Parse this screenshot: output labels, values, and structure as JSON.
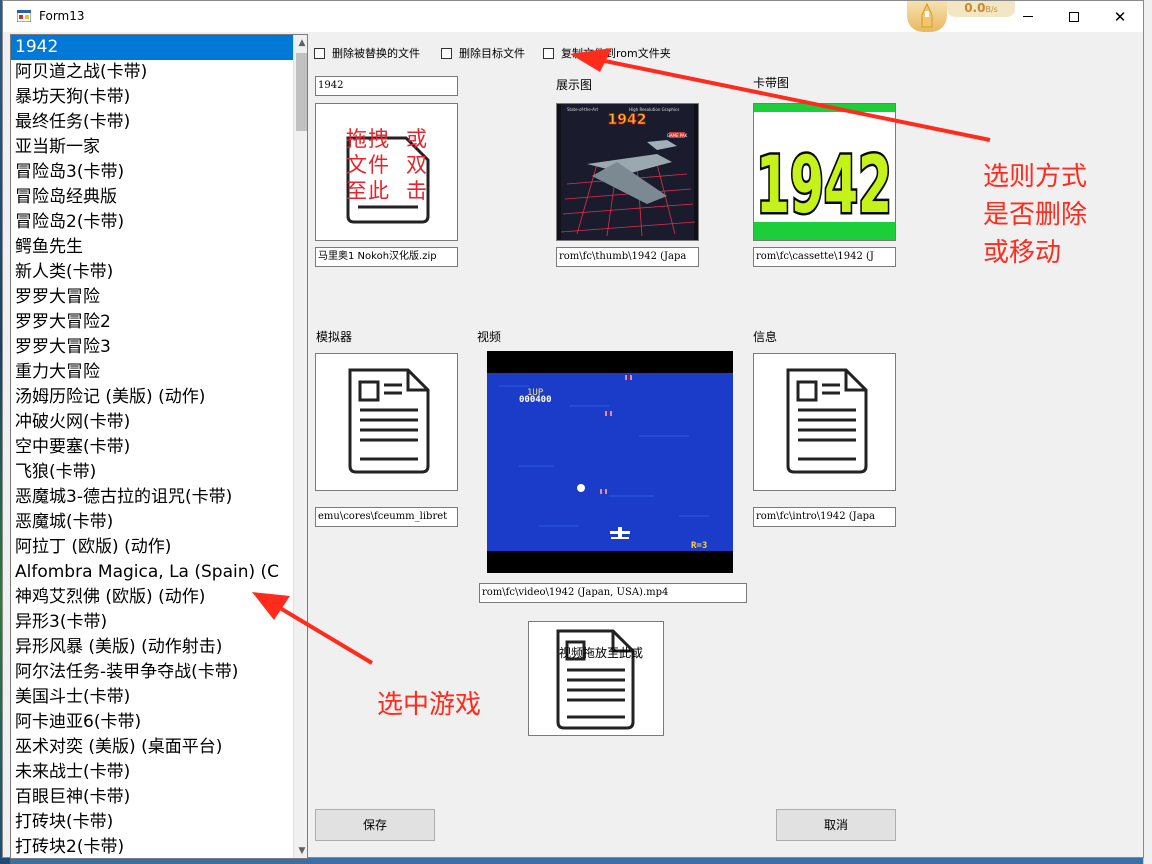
{
  "window": {
    "title": "Form13",
    "speed_text": "0.0",
    "speed_unit": "B/s"
  },
  "game_list": {
    "selected_index": 0,
    "items": [
      "1942",
      "阿贝道之战(卡带)",
      "暴坊天狗(卡带)",
      "最终任务(卡带)",
      "亚当斯一家",
      "冒险岛3(卡带)",
      "冒险岛经典版",
      "冒险岛2(卡带)",
      "鳄鱼先生",
      "新人类(卡带)",
      "罗罗大冒险",
      "罗罗大冒险2",
      "罗罗大冒险3",
      "重力大冒险",
      "汤姆历险记 (美版) (动作)",
      "冲破火网(卡带)",
      "空中要塞(卡带)",
      "飞狼(卡带)",
      "恶魔城3-德古拉的诅咒(卡带)",
      "恶魔城(卡带)",
      "阿拉丁 (欧版) (动作)",
      "Alfombra Magica, La (Spain) (C",
      "神鸡艾烈佛 (欧版) (动作)",
      "异形3(卡带)",
      "异形风暴 (美版) (动作射击)",
      "阿尔法任务-装甲争夺战(卡带)",
      "美国斗士(卡带)",
      "阿卡迪亚6(卡带)",
      "巫术对奕 (美版) (桌面平台)",
      "未来战士(卡带)",
      "百眼巨神(卡带)",
      "打砖块(卡带)",
      "打砖块2(卡带)"
    ]
  },
  "options": {
    "delete_replaced": "删除被替换的文件",
    "delete_target": "删除目标文件",
    "copy_to_rom": "复制文件到rom文件夹"
  },
  "rom": {
    "name_value": "1942",
    "drop_text": [
      "拖拽",
      "文件",
      "至此"
    ],
    "drop_text2": [
      "或",
      "双",
      "击"
    ],
    "path": "马里奥1 Nokoh汉化版.zip"
  },
  "display": {
    "label": "展示图",
    "path": "rom\\fc\\thumb\\1942 (Japa",
    "cover_title": "1942",
    "cover_top_left": "State-of-the-Art",
    "cover_top_right": "High Resolution Graphics",
    "cover_badge": "GAME PAK"
  },
  "cassette": {
    "label": "卡带图",
    "path": "rom\\fc\\cassette\\1942 (J",
    "logo_text": "1942"
  },
  "emulator": {
    "label": "模拟器",
    "path": "emu\\cores\\fceumm_libret"
  },
  "video": {
    "label": "视频",
    "path": "rom\\fc\\video\\1942 (Japan, USA).mp4",
    "hud_1up": "1UP",
    "hud_score": "000400",
    "hud_lives": "R=3"
  },
  "info": {
    "label": "信息",
    "path": "rom\\fc\\intro\\1942 (Japa"
  },
  "video_drop": {
    "text": "视频拖放至此或"
  },
  "buttons": {
    "save": "保存",
    "cancel": "取消"
  },
  "annotations": {
    "choose_mode": [
      "选则方式",
      "是否删除",
      "或移动"
    ],
    "select_game": "选中游戏"
  },
  "colors": {
    "selection": "#0078d7",
    "annotation": "#ff2b1d",
    "video_bg": "#1a3cc8"
  }
}
